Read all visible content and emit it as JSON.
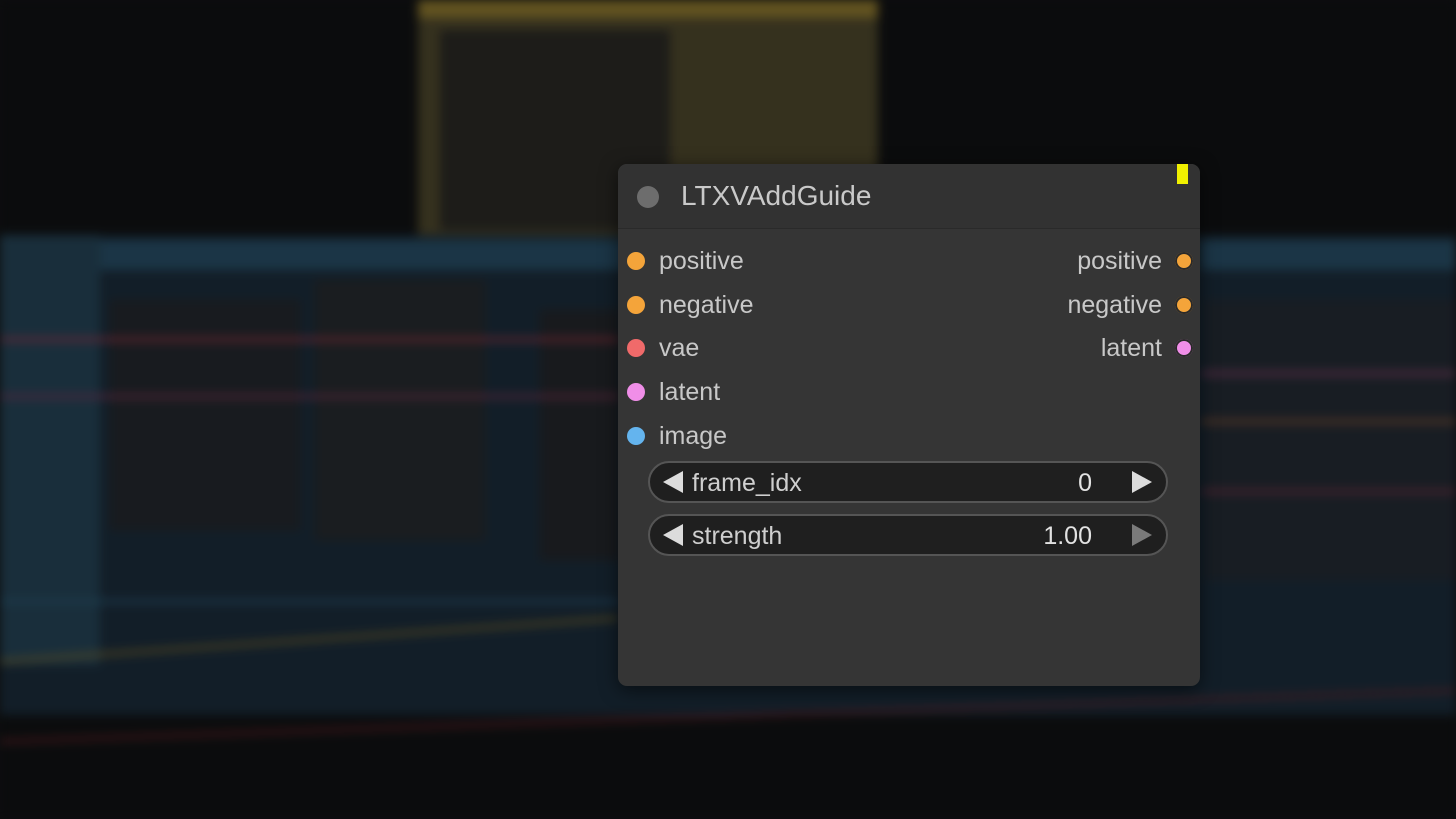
{
  "colors": {
    "node_body": "#353535",
    "slot_conditioning": "#f4a43a",
    "slot_vae": "#f06a6a",
    "slot_latent": "#f08ee8",
    "slot_image": "#64b4ee",
    "badge": "#f0f000"
  },
  "node": {
    "title": "LTXVAddGuide",
    "inputs": [
      {
        "label": "positive",
        "color": "#f4a43a"
      },
      {
        "label": "negative",
        "color": "#f4a43a"
      },
      {
        "label": "vae",
        "color": "#f06a6a"
      },
      {
        "label": "latent",
        "color": "#f08ee8"
      },
      {
        "label": "image",
        "color": "#64b4ee"
      }
    ],
    "outputs": [
      {
        "label": "positive",
        "color": "#f4a43a"
      },
      {
        "label": "negative",
        "color": "#f4a43a"
      },
      {
        "label": "latent",
        "color": "#f08ee8"
      }
    ],
    "widgets": [
      {
        "label": "frame_idx",
        "value": "0"
      },
      {
        "label": "strength",
        "value": "1.00"
      }
    ]
  },
  "icons": {
    "collapse": "collapse-dot-icon",
    "decrement": "triangle-left-icon",
    "increment": "triangle-right-icon"
  }
}
